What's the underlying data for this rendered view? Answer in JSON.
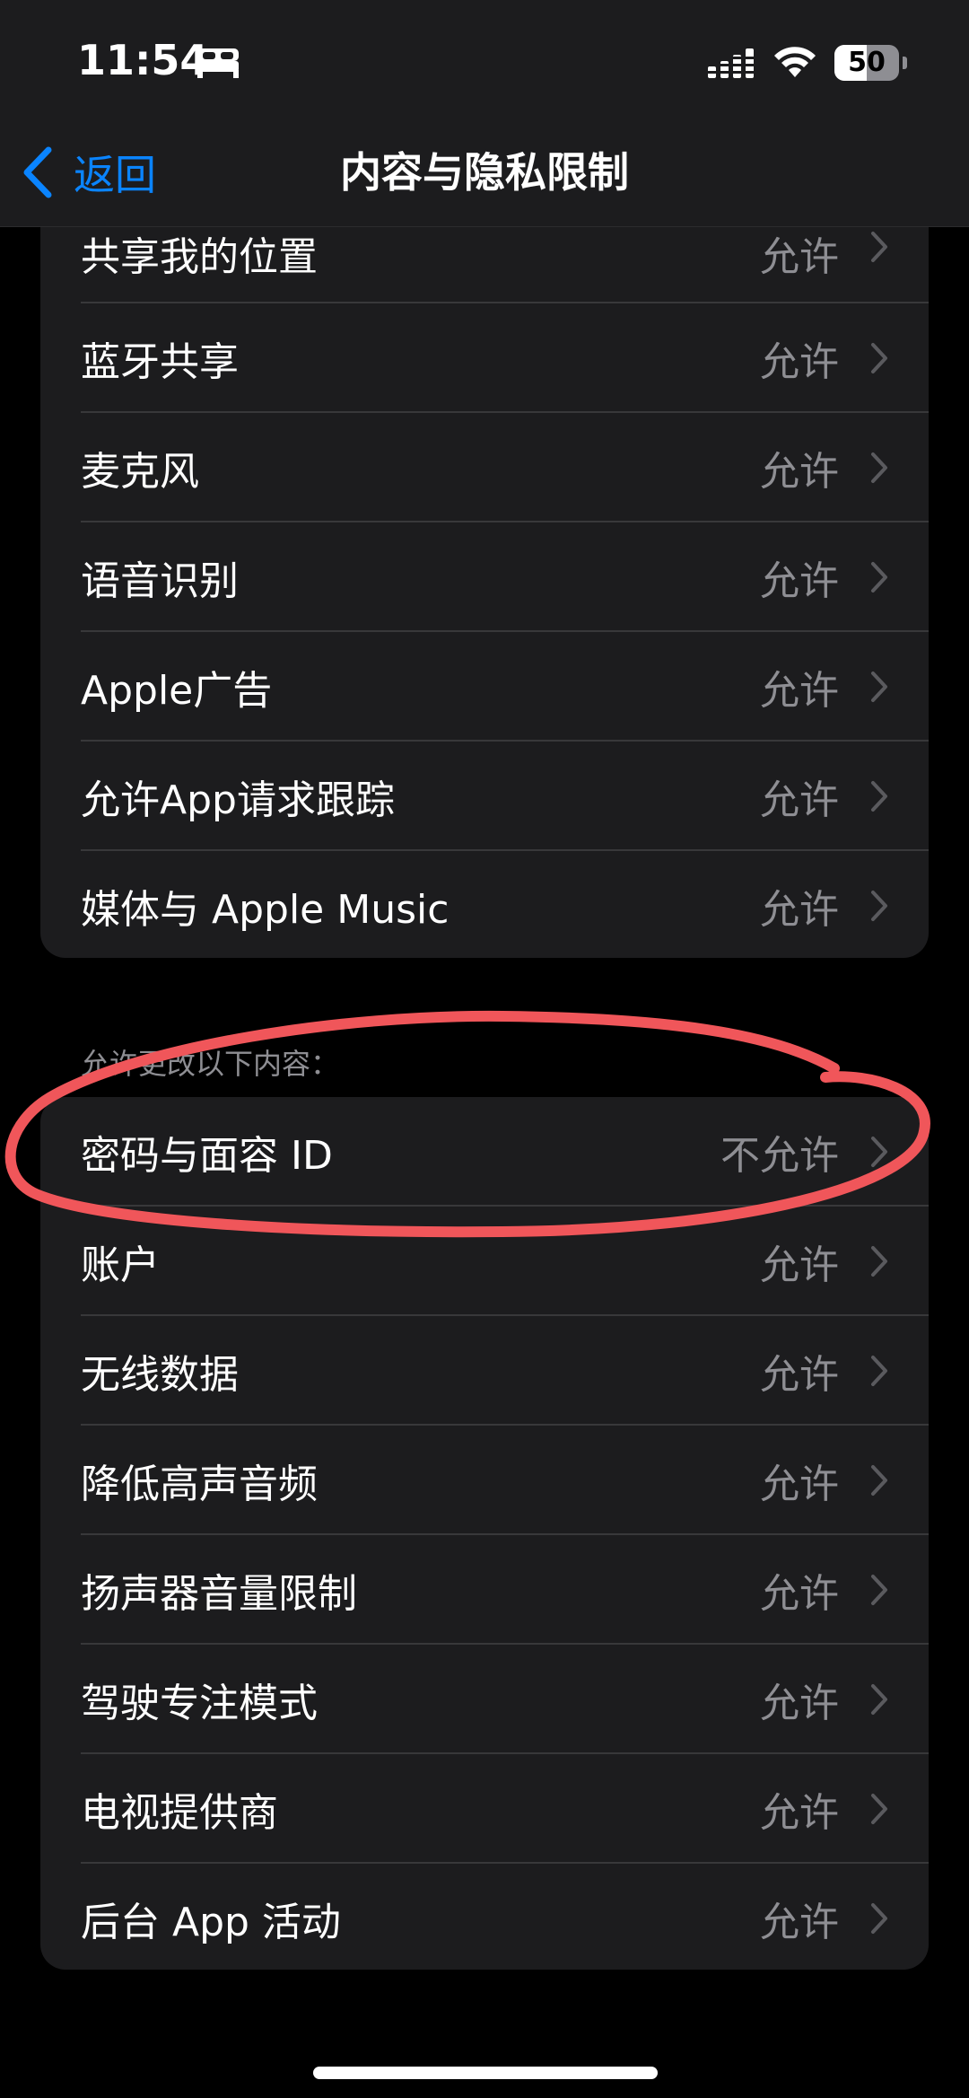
{
  "status_bar": {
    "time": "11:54",
    "battery_level": "50",
    "battery_fraction": 0.5,
    "icons": [
      "bed-icon",
      "cellular-signal-icon",
      "wifi-icon",
      "battery-icon"
    ]
  },
  "nav": {
    "back_label": "返回",
    "title": "内容与隐私限制"
  },
  "group_privacy": {
    "items": [
      {
        "label": "共享我的位置",
        "value": "允许"
      },
      {
        "label": "蓝牙共享",
        "value": "允许"
      },
      {
        "label": "麦克风",
        "value": "允许"
      },
      {
        "label": "语音识别",
        "value": "允许"
      },
      {
        "label": "Apple广告",
        "value": "允许"
      },
      {
        "label": "允许App请求跟踪",
        "value": "允许"
      },
      {
        "label": "媒体与 Apple Music",
        "value": "允许"
      }
    ]
  },
  "group_changes": {
    "header": "允许更改以下内容：",
    "items": [
      {
        "label": "密码与面容 ID",
        "value": "不允许"
      },
      {
        "label": "账户",
        "value": "允许"
      },
      {
        "label": "无线数据",
        "value": "允许"
      },
      {
        "label": "降低高声音频",
        "value": "允许"
      },
      {
        "label": "扬声器音量限制",
        "value": "允许"
      },
      {
        "label": "驾驶专注模式",
        "value": "允许"
      },
      {
        "label": "电视提供商",
        "value": "允许"
      },
      {
        "label": "后台 App 活动",
        "value": "允许"
      }
    ]
  },
  "colors": {
    "accent": "#0a84ff",
    "annotation": "#f0565a",
    "cell_background": "#1c1c1e",
    "secondary_text": "#8e8e93"
  }
}
